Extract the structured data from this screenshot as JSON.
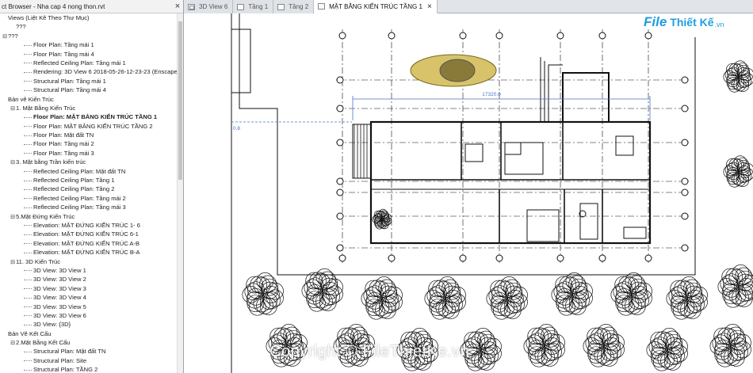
{
  "browser": {
    "title": "ct Browser - Nha cap 4 nong thon.rvt",
    "close_glyph": "×",
    "nodes": [
      {
        "indent": 0,
        "toggle": "",
        "label": "Views (Liệt Kê Theo Thư Mục)"
      },
      {
        "indent": 1,
        "toggle": "",
        "label": "???"
      },
      {
        "indent": 0,
        "toggle": "⊟",
        "label": "???"
      },
      {
        "indent": 2,
        "toggle": "",
        "label": "Floor Plan: Tầng mái 1"
      },
      {
        "indent": 2,
        "toggle": "",
        "label": "Floor Plan: Tầng mái 4"
      },
      {
        "indent": 2,
        "toggle": "",
        "label": "Reflected Ceiling Plan: Tầng mái 1"
      },
      {
        "indent": 2,
        "toggle": "",
        "label": "Rendering: 3D View 6 2018-05-26-12-23-23 (Enscape"
      },
      {
        "indent": 2,
        "toggle": "",
        "label": "Structural Plan: Tầng mái 1"
      },
      {
        "indent": 2,
        "toggle": "",
        "label": "Structural Plan: Tầng mái 4"
      },
      {
        "indent": 0,
        "toggle": "",
        "label": "Bản vẽ Kiến Trúc"
      },
      {
        "indent": 1,
        "toggle": "⊟",
        "label": "1. Mặt Bằng Kiến Trúc"
      },
      {
        "indent": 2,
        "toggle": "",
        "label": "Floor Plan: MẶT BẰNG KIẾN TRÚC TẦNG 1",
        "active": true
      },
      {
        "indent": 2,
        "toggle": "",
        "label": "Floor Plan: MẶT BẰNG KIẾN TRÚC TẦNG 2"
      },
      {
        "indent": 2,
        "toggle": "",
        "label": "Floor Plan: Mặt đất TN"
      },
      {
        "indent": 2,
        "toggle": "",
        "label": "Floor Plan: Tầng mái 2"
      },
      {
        "indent": 2,
        "toggle": "",
        "label": "Floor Plan: Tầng mái 3"
      },
      {
        "indent": 1,
        "toggle": "⊟",
        "label": "3. Mặt bằng Trần kiến trúc"
      },
      {
        "indent": 2,
        "toggle": "",
        "label": "Reflected Ceiling Plan: Mặt đất TN"
      },
      {
        "indent": 2,
        "toggle": "",
        "label": "Reflected Ceiling Plan: Tầng 1"
      },
      {
        "indent": 2,
        "toggle": "",
        "label": "Reflected Ceiling Plan: Tầng 2"
      },
      {
        "indent": 2,
        "toggle": "",
        "label": "Reflected Ceiling Plan: Tầng mái 2"
      },
      {
        "indent": 2,
        "toggle": "",
        "label": "Reflected Ceiling Plan: Tầng mái 3"
      },
      {
        "indent": 1,
        "toggle": "⊟",
        "label": "5.Mặt Đứng Kiến Trúc"
      },
      {
        "indent": 2,
        "toggle": "",
        "label": "Elevation: MẶT ĐỨNG KIẾN TRÚC 1- 6"
      },
      {
        "indent": 2,
        "toggle": "",
        "label": "Elevation: MẶT ĐỨNG KIẾN TRÚC 6-1"
      },
      {
        "indent": 2,
        "toggle": "",
        "label": "Elevation: MẶT ĐỨNG KIẾN TRÚC A-B"
      },
      {
        "indent": 2,
        "toggle": "",
        "label": "Elevation: MẶT ĐỨNG KIẾN TRÚC B-A"
      },
      {
        "indent": 1,
        "toggle": "⊟",
        "label": "11. 3D Kiến Trúc"
      },
      {
        "indent": 2,
        "toggle": "",
        "label": "3D View: 3D View 1"
      },
      {
        "indent": 2,
        "toggle": "",
        "label": "3D View: 3D View 2"
      },
      {
        "indent": 2,
        "toggle": "",
        "label": "3D View: 3D View 3"
      },
      {
        "indent": 2,
        "toggle": "",
        "label": "3D View: 3D View 4"
      },
      {
        "indent": 2,
        "toggle": "",
        "label": "3D View: 3D View 5"
      },
      {
        "indent": 2,
        "toggle": "",
        "label": "3D View: 3D View 6"
      },
      {
        "indent": 2,
        "toggle": "",
        "label": "3D View: {3D}"
      },
      {
        "indent": 0,
        "toggle": "",
        "label": "Bản Vẽ Kết Cấu"
      },
      {
        "indent": 1,
        "toggle": "⊟",
        "label": "2.Mặt Bằng Kết Cấu"
      },
      {
        "indent": 2,
        "toggle": "",
        "label": "Structural Plan: Mặt đất TN"
      },
      {
        "indent": 2,
        "toggle": "",
        "label": "Structural Plan: Site"
      },
      {
        "indent": 2,
        "toggle": "",
        "label": "Structural Plan: TẦNG 2"
      }
    ]
  },
  "tabs": [
    {
      "label": "3D View 6",
      "icon": "3d-view-icon",
      "active": false
    },
    {
      "label": "Tầng 1",
      "icon": "floor-plan-icon",
      "active": false
    },
    {
      "label": "Tầng 2",
      "icon": "floor-plan-icon",
      "active": false
    },
    {
      "label": "MẶT BẰNG KIẾN TRÚC TẦNG 1",
      "icon": "floor-plan-icon",
      "active": true
    }
  ],
  "tab_close_glyph": "×",
  "drawing": {
    "dimension_text": "17320.0",
    "side_dimension_text": "0.8",
    "watermark": "Copyright © FileThietKe.vn",
    "logo": {
      "part1": "File",
      "part2": "Thiết Kế",
      "part3": ".vn"
    },
    "colors": {
      "line": "#111111",
      "dimension": "#4a73c8",
      "car_body": "#d8c36a"
    }
  }
}
